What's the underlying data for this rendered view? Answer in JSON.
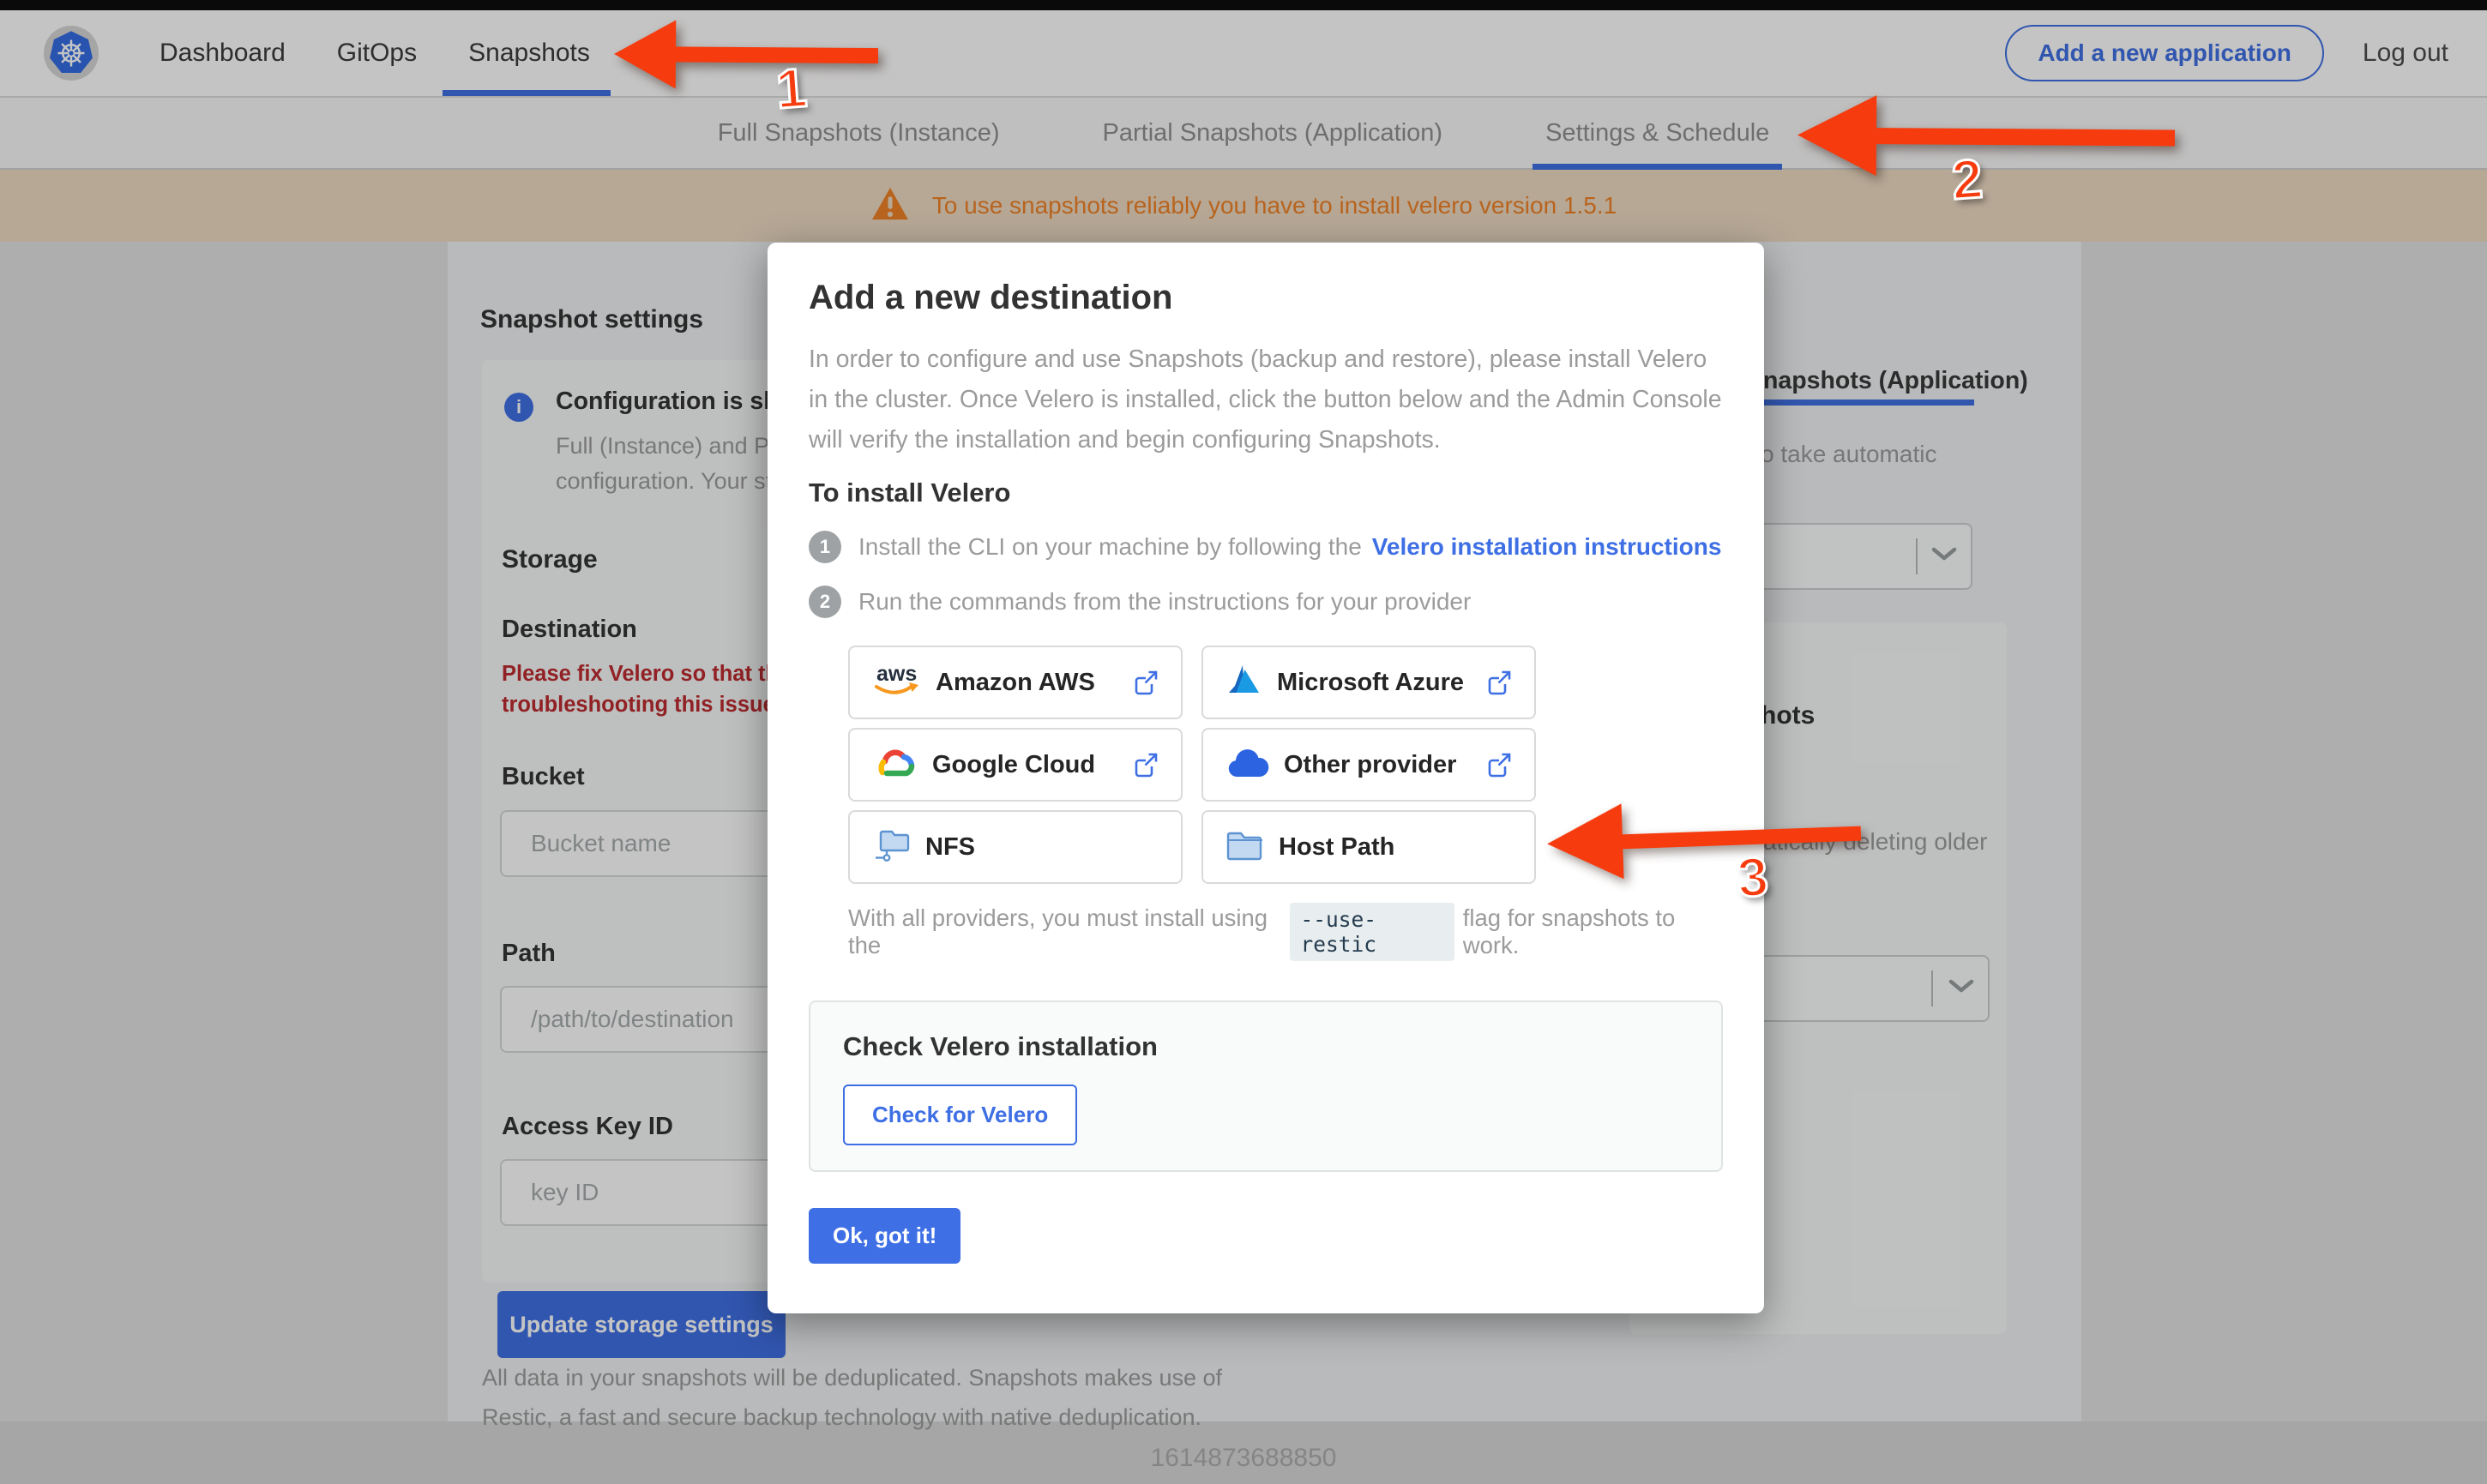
{
  "colors": {
    "accent_blue": "#3e6fe4",
    "arrow_red": "#f63b0e",
    "error_red": "#bc292d",
    "warning_orange": "#ef8125",
    "banner_bg": "#eedac3"
  },
  "nav": {
    "items": [
      {
        "label": "Dashboard",
        "active": false
      },
      {
        "label": "GitOps",
        "active": false
      },
      {
        "label": "Snapshots",
        "active": true
      }
    ],
    "add_app_label": "Add a new application",
    "logout_label": "Log out"
  },
  "subnav": {
    "tabs": [
      {
        "label": "Full Snapshots (Instance)",
        "active": false
      },
      {
        "label": "Partial Snapshots (Application)",
        "active": false
      },
      {
        "label": "Settings & Schedule",
        "active": true
      }
    ]
  },
  "banner": {
    "text": "To use snapshots reliably you have to install velero version 1.5.1"
  },
  "modal": {
    "title": "Add a new destination",
    "intro": "In order to configure and use Snapshots (backup and restore), please install Velero in the cluster. Once Velero is installed, click the button below and the Admin Console will verify the installation and begin configuring Snapshots.",
    "section_heading": "To install Velero",
    "steps": [
      {
        "number": "1",
        "text": "Install the CLI on your machine by following the",
        "link": "Velero installation instructions"
      },
      {
        "number": "2",
        "text": "Run the commands from the instructions for your provider"
      }
    ],
    "providers": [
      {
        "label": "Amazon AWS",
        "icon": "aws-icon",
        "external": true
      },
      {
        "label": "Microsoft Azure",
        "icon": "azure-icon",
        "external": true
      },
      {
        "label": "Google Cloud",
        "icon": "google-cloud-icon",
        "external": true
      },
      {
        "label": "Other provider",
        "icon": "cloud-icon",
        "external": true
      },
      {
        "label": "NFS",
        "icon": "nfs-folder-icon",
        "external": false
      },
      {
        "label": "Host Path",
        "icon": "folder-icon",
        "external": false
      }
    ],
    "restic_note": {
      "before": "With all providers, you must install using the",
      "code": "--use-restic",
      "after": "flag for snapshots to work."
    },
    "check_card": {
      "title": "Check Velero installation",
      "button_label": "Check for Velero"
    },
    "ok_button_label": "Ok, got it!"
  },
  "settings_page": {
    "heading": "Snapshot settings",
    "info_box": {
      "title_fragment": "Configuration is sh",
      "line1_fragment": "Full (Instance) and Parti",
      "line2_fragment": "configuration. Your stor"
    },
    "storage": {
      "heading": "Storage",
      "destination_label": "Destination",
      "error_line1": "Please fix Velero so that th",
      "error_line2": "troubleshooting this issue",
      "bucket_label": "Bucket",
      "bucket_placeholder": "Bucket name",
      "path_label": "Path",
      "path_placeholder": "/path/to/destination",
      "access_key_label": "Access Key ID",
      "access_key_placeholder": "key ID",
      "update_button_label": "Update storage settings"
    },
    "dedup_line1": "All data in your snapshots will be deduplicated. Snapshots makes use of",
    "dedup_line2": "Restic, a fast and secure backup technology with native deduplication.",
    "right_column": {
      "tab_fragment": "napshots (Application)",
      "auto_text_fragment": "o take automatic",
      "heading_fragment": "hots",
      "deleting_text_fragment": "atically deleting older"
    }
  },
  "footer": {
    "timestamp": "1614873688850"
  },
  "annotations": {
    "labels": [
      "1",
      "2",
      "3"
    ]
  }
}
